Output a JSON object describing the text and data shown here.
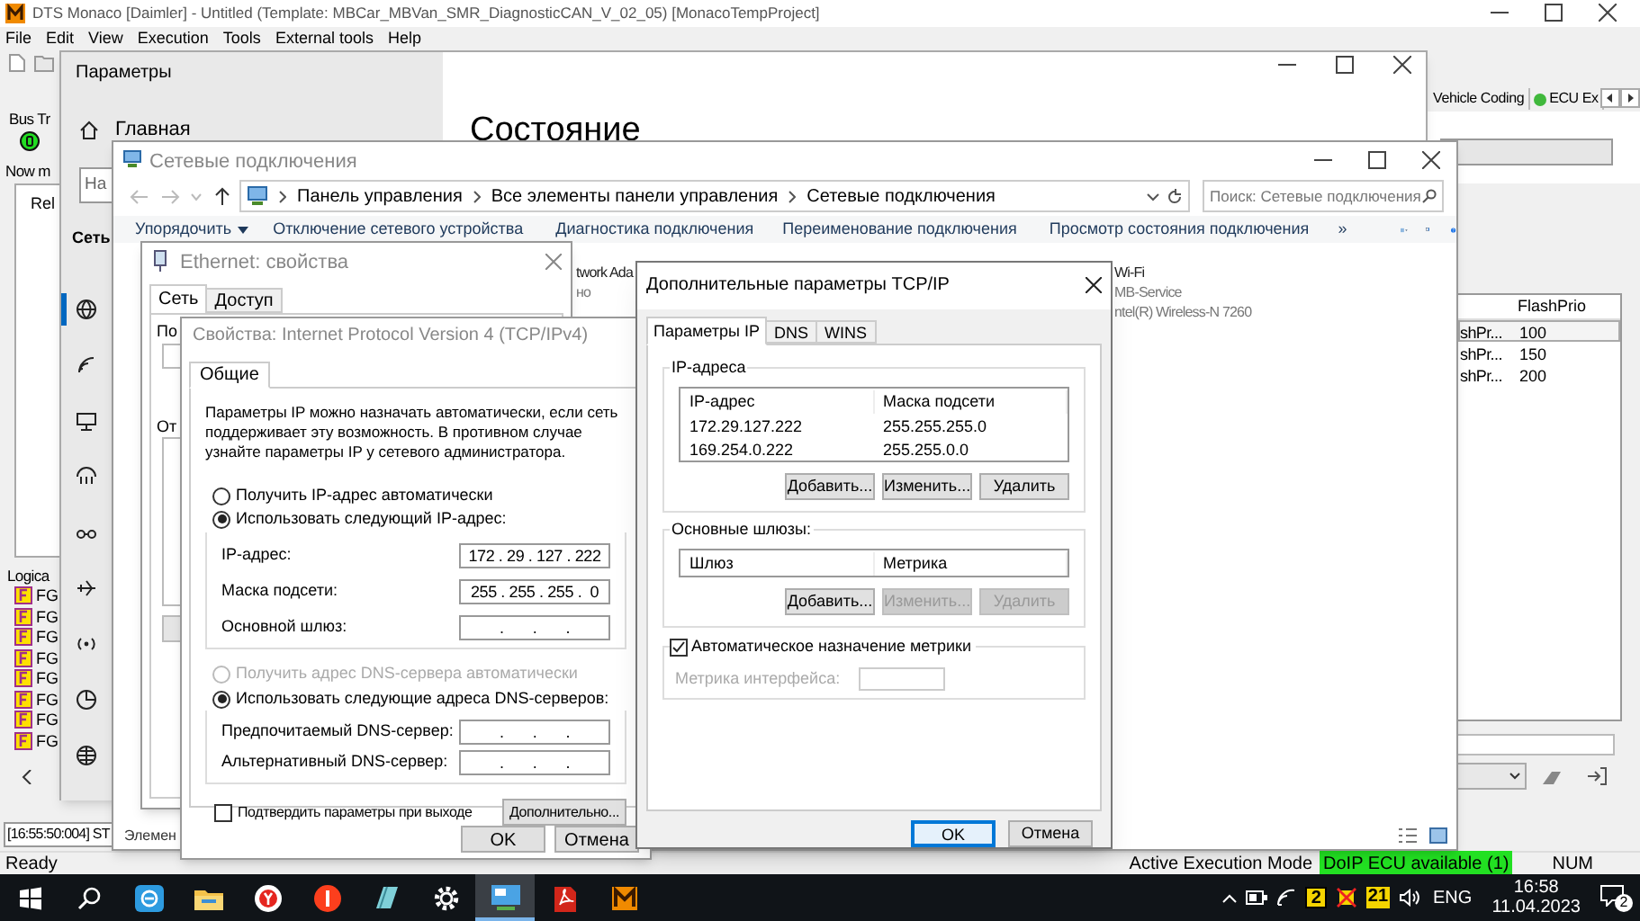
{
  "monaco": {
    "title": "DTS Monaco [Daimler] - Untitled (Template: MBCar_MBVan_SMR_DiagnosticCAN_V_02_05) [MonacoTempProject]",
    "menu": [
      "File",
      "Edit",
      "View",
      "Execution",
      "Tools",
      "External tools",
      "Help"
    ],
    "bus_group": "Bus Tr",
    "now_label": "Now m",
    "list_item": "Rel",
    "logical_group": "Logica",
    "logical_items": [
      "FG",
      "FG",
      "FG",
      "FG",
      "FG",
      "FG",
      "FG",
      "FG"
    ],
    "log_line": "[16:55:50:004] ST",
    "tabs": [
      {
        "label": "Vehicle Coding",
        "dot": false
      },
      {
        "label": "ECU Ex",
        "dot": true
      }
    ],
    "table": {
      "columns": [
        "FlashPrio"
      ],
      "rows": [
        {
          "column_1": "shPr...",
          "flashprio": "100",
          "selected": true
        },
        {
          "column_1": "shPr...",
          "flashprio": "150",
          "selected": false
        },
        {
          "column_1": "shPr...",
          "flashprio": "200",
          "selected": false
        }
      ]
    },
    "status": {
      "text": "Ready",
      "mode_label": "Active Execution Mode",
      "mode_value": "DoIP ECU available (1)",
      "num": "NUM"
    }
  },
  "settings": {
    "title": "Параметры",
    "home": "Главная",
    "search_placeholder": "На",
    "section": "Сеть",
    "heading": "Состояние"
  },
  "network_connections": {
    "title": "Сетевые подключения",
    "breadcrumb": [
      "Панель управления",
      "Все элементы панели управления",
      "Сетевые подключения"
    ],
    "search_placeholder": "Поиск: Сетевые подключения",
    "toolbar": [
      "Упорядочить",
      "Отключение сетевого устройства",
      "Диагностика подключения",
      "Переименование подключения",
      "Просмотр состояния подключения",
      "»"
    ],
    "adapters": [
      {
        "lines": [
          "twork Ada",
          "но"
        ]
      },
      {
        "lines": [
          "Wi-Fi",
          "MB-Service",
          "ntel(R) Wireless-N 7260"
        ]
      }
    ],
    "status": "Элемен"
  },
  "ethernet_properties": {
    "title": "Ethernet: свойства",
    "tabs": [
      {
        "label": "Сеть",
        "selected": true
      },
      {
        "label": "Доступ",
        "selected": false
      }
    ],
    "fragments": [
      "По",
      "От"
    ]
  },
  "ipv4_properties": {
    "title": "Свойства: Internet Protocol Version 4 (TCP/IPv4)",
    "tab": "Общие",
    "description": "Параметры IP можно назначать автоматически, если сеть поддерживает эту возможность. В противном случае узнайте параметры IP у сетевого администратора.",
    "ip_options": [
      {
        "label": "Получить IP-адрес автоматически",
        "selected": false,
        "disabled": false
      },
      {
        "label": "Использовать следующий IP-адрес:",
        "selected": true,
        "disabled": false
      }
    ],
    "ip_fields": [
      {
        "label": "IP-адрес:",
        "value": "172 . 29 . 127 . 222"
      },
      {
        "label": "Маска подсети:",
        "value": "255 . 255 . 255 .  0"
      },
      {
        "label": "Основной шлюз:",
        "value": ".       .       ."
      }
    ],
    "dns_options": [
      {
        "label": "Получить адрес DNS-сервера автоматически",
        "selected": false,
        "disabled": true
      },
      {
        "label": "Использовать следующие адреса DNS-серверов:",
        "selected": true,
        "disabled": false
      }
    ],
    "dns_fields": [
      {
        "label": "Предпочитаемый DNS-сервер:",
        "value": ".       .       ."
      },
      {
        "label": "Альтернативный DNS-сервер:",
        "value": ".       .       ."
      }
    ],
    "validate": {
      "label": "Подтвердить параметры при выходе",
      "checked": false
    },
    "advanced_button": "Дополнительно...",
    "buttons": [
      "OK",
      "Отмена"
    ]
  },
  "advanced_tcpip": {
    "title": "Дополнительные параметры TCP/IP",
    "tabs": [
      {
        "label": "Параметры IP",
        "selected": true
      },
      {
        "label": "DNS",
        "selected": false
      },
      {
        "label": "WINS",
        "selected": false
      }
    ],
    "ip_group": {
      "title": "IP-адреса",
      "columns": [
        "IP-адрес",
        "Маска подсети"
      ],
      "rows": [
        [
          "172.29.127.222",
          "255.255.255.0"
        ],
        [
          "169.254.0.222",
          "255.255.0.0"
        ]
      ],
      "buttons": [
        {
          "label": "Добавить...",
          "disabled": false
        },
        {
          "label": "Изменить...",
          "disabled": false
        },
        {
          "label": "Удалить",
          "disabled": false
        }
      ]
    },
    "gateway_group": {
      "title": "Основные шлюзы:",
      "columns": [
        "Шлюз",
        "Метрика"
      ],
      "buttons": [
        {
          "label": "Добавить...",
          "disabled": false
        },
        {
          "label": "Изменить...",
          "disabled": true
        },
        {
          "label": "Удалить",
          "disabled": true
        }
      ]
    },
    "auto_metric": {
      "label": "Автоматическое назначение метрики",
      "checked": true
    },
    "metric_label": "Метрика интерфейса:",
    "buttons": [
      "OK",
      "Отмена"
    ]
  },
  "taskbar": {
    "apps": [
      {
        "kind": "start",
        "active": false
      },
      {
        "kind": "search",
        "active": false
      },
      {
        "kind": "blue-app",
        "active": false
      },
      {
        "kind": "folder",
        "active": false
      },
      {
        "kind": "y-browser",
        "active": false
      },
      {
        "kind": "y-app",
        "active": false
      },
      {
        "kind": "notes",
        "active": false
      },
      {
        "kind": "settings",
        "active": false
      },
      {
        "kind": "network",
        "active": true
      },
      {
        "kind": "pdf",
        "active": false
      },
      {
        "kind": "monaco",
        "active": false
      }
    ],
    "tray_badges": [
      "2",
      "21"
    ],
    "language": "ENG",
    "time": "16:58",
    "date": "11.04.2023",
    "notifications": "2"
  }
}
